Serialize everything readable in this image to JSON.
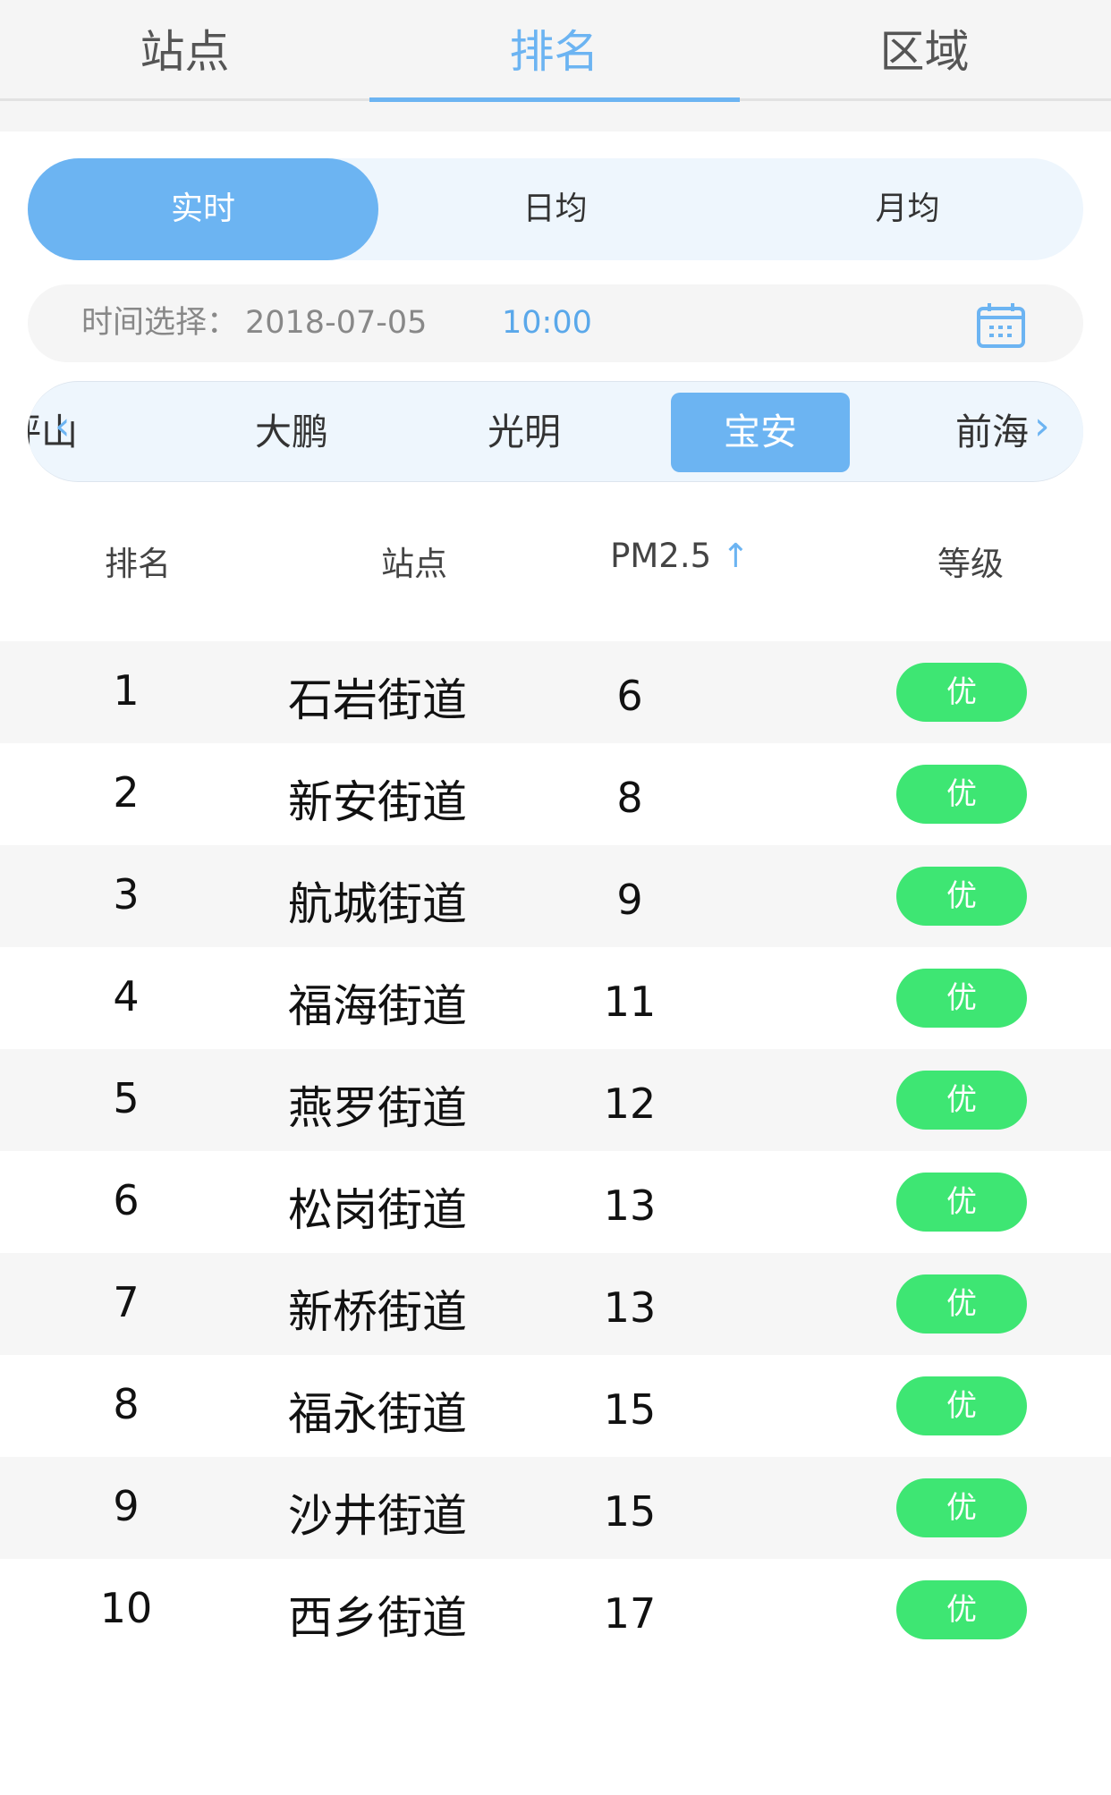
{
  "tabs": [
    "站点",
    "排名",
    "区域"
  ],
  "period": [
    "实时",
    "日均",
    "月均"
  ],
  "time": {
    "label": "时间选择：",
    "date": "2018-07-05",
    "hour": "10:00"
  },
  "districts": [
    "坪山",
    "大鹏",
    "光明",
    "宝安",
    "前海"
  ],
  "headers": [
    "排名",
    "站点",
    "PM2.5",
    "等级"
  ],
  "rows": [
    {
      "rank": "1",
      "station": "石岩街道",
      "pm": "6",
      "level": "优"
    },
    {
      "rank": "2",
      "station": "新安街道",
      "pm": "8",
      "level": "优"
    },
    {
      "rank": "3",
      "station": "航城街道",
      "pm": "9",
      "level": "优"
    },
    {
      "rank": "4",
      "station": "福海街道",
      "pm": "11",
      "level": "优"
    },
    {
      "rank": "5",
      "station": "燕罗街道",
      "pm": "12",
      "level": "优"
    },
    {
      "rank": "6",
      "station": "松岗街道",
      "pm": "13",
      "level": "优"
    },
    {
      "rank": "7",
      "station": "新桥街道",
      "pm": "13",
      "level": "优"
    },
    {
      "rank": "8",
      "station": "福永街道",
      "pm": "15",
      "level": "优"
    },
    {
      "rank": "9",
      "station": "沙井街道",
      "pm": "15",
      "level": "优"
    },
    {
      "rank": "10",
      "station": "西乡街道",
      "pm": "17",
      "level": "优"
    }
  ]
}
